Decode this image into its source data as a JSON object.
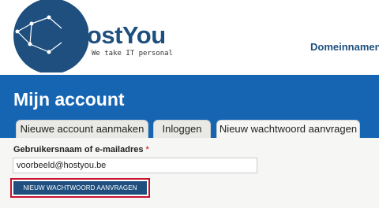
{
  "brand": {
    "name": "HostYou",
    "tagline": "We take IT personal",
    "logo_icon": "globe-network-icon",
    "color": "#1e4f7e"
  },
  "nav": {
    "domains": "Domeinnamen"
  },
  "hero": {
    "title": "Mijn account",
    "background": "#1565b3"
  },
  "tabs": [
    {
      "label": "Nieuwe account aanmaken",
      "active": false
    },
    {
      "label": "Inloggen",
      "active": false
    },
    {
      "label": "Nieuw wachtwoord aanvragen",
      "active": true
    }
  ],
  "form": {
    "username_label": "Gebruikersnaam of e-mailadres",
    "required_marker": "*",
    "username_value": "voorbeeld@hostyou.be",
    "submit_label": "NIEUW WACHTWOORD AANVRAGEN"
  },
  "colors": {
    "required": "#cc0000",
    "focus_outline": "#c8102e",
    "button": "#1e4f7e"
  }
}
